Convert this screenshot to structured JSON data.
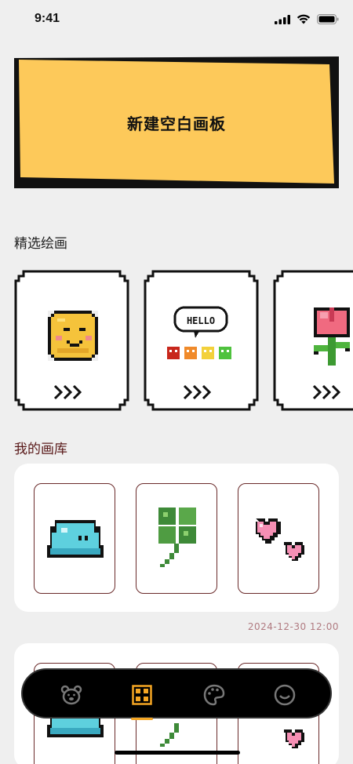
{
  "status": {
    "time": "9:41"
  },
  "new_board": {
    "label": "新建空白画板"
  },
  "featured": {
    "title": "精选绘画",
    "cards": [
      {
        "name": "smiley",
        "arrows": ">>>"
      },
      {
        "name": "hello-bubble",
        "speech_text": "HELLO",
        "arrows": ">>>"
      },
      {
        "name": "tulip",
        "arrows": ">>>"
      }
    ]
  },
  "gallery": {
    "title": "我的画库",
    "groups": [
      {
        "items": [
          "slime",
          "clover",
          "hearts"
        ],
        "date": "2024-12-30   12:00"
      },
      {
        "items": [
          "slime",
          "clover",
          "hearts"
        ]
      }
    ]
  },
  "tab_bar": {
    "tabs": [
      {
        "icon": "bear-icon",
        "active": false
      },
      {
        "icon": "grid-icon",
        "active": true
      },
      {
        "icon": "palette-icon",
        "active": false
      },
      {
        "icon": "smile-icon",
        "active": false
      }
    ],
    "accent": "#f5a623"
  },
  "colors": {
    "board_yellow": "#fdc95a",
    "gallery_label": "#5a1a1a",
    "date": "#b07a80"
  }
}
